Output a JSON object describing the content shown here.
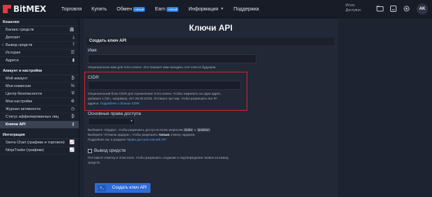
{
  "brand": {
    "name": "BitMEX",
    "color": "#e5393a"
  },
  "nav": {
    "items": [
      {
        "label": "Торговля",
        "badge": ""
      },
      {
        "label": "Купить",
        "badge": ""
      },
      {
        "label": "Обмен",
        "badge": "новый"
      },
      {
        "label": "Earn",
        "badge": "новый"
      },
      {
        "label": "Информация",
        "badge": ""
      },
      {
        "label": "Поддержка",
        "badge": ""
      }
    ]
  },
  "balance": {
    "total_label": "Итого",
    "available_label": "Доступно"
  },
  "user": {
    "initials": "AK"
  },
  "sidebar": {
    "wallet_title": "Кошелек",
    "wallet_items": [
      {
        "label": "Баланс средств",
        "icon": "bank-icon"
      },
      {
        "label": "Депозит",
        "icon": "download-icon"
      },
      {
        "label": "Вывод средств",
        "icon": "upload-icon"
      },
      {
        "label": "История",
        "icon": "list-icon"
      },
      {
        "label": "Адреса",
        "icon": "bookmark-icon"
      }
    ],
    "account_title": "Аккаунт и настройки",
    "account_items": [
      {
        "label": "Мой аккаунт",
        "icon": "bitcoin-icon"
      },
      {
        "label": "Мои комиссии",
        "icon": "percent-icon"
      },
      {
        "label": "Центр безопасности",
        "icon": "shield-icon"
      },
      {
        "label": "Мои настройки",
        "icon": "gear-icon"
      },
      {
        "label": "Журнал активности",
        "icon": "clock-icon"
      },
      {
        "label": "Статус аффилированных лиц",
        "icon": "bitcoin-icon"
      },
      {
        "label": "Ключи API",
        "icon": "key-icon"
      }
    ],
    "integration_title": "Интеграция",
    "integration_items": [
      {
        "label": "Sierra Chart (графики и торговля)",
        "icon": "chart-icon"
      },
      {
        "label": "NinjaTrader (графики)",
        "icon": "chart-icon"
      }
    ]
  },
  "page": {
    "title": "Ключи API",
    "card_title": "Создать ключ API",
    "name_label": "Имя",
    "name_hint": "Опциональное имя для этого ключа. Это поможет вам находить этот ключ в будущем.",
    "cidr_label": "CIDR",
    "cidr_hint_1": "Опциональный блок CIDR для ограничения этого ключа. Чтобы закрепить на один адрес,",
    "cidr_hint_2": "добавьте к /32», например, 207.39.29.22/32. Оставьте пустым, чтобы разрешить все IP-",
    "cidr_hint_3a": "адреса.",
    "cidr_hint_link": "Подробнее о блоках CIDR",
    "perm_label": "Основные права доступа",
    "perm_hint_1": "Выберите «Ордер», чтобы разрешить доступ ко всем запросам",
    "perm_code_1": "/order",
    "perm_and": "и",
    "perm_code_2": "/position",
    "perm_hint_2a": "Выберите «Отмена ордера», чтобы разрешить",
    "perm_hint_2b": "только",
    "perm_hint_2c": "отмену ордеров.",
    "perm_hint_3a": "Подробнее см. в разделе",
    "perm_hint_link": "Права доступа ключей API",
    "withdraw_label": "Вывод средств",
    "withdraw_hint_1": "Поставьте отметку в этом поле, чтобы разрешить создание и подтверждение заявок на вывод",
    "withdraw_hint_2": "средств.",
    "create_button": "Создать ключ API",
    "create_button_icon": "terminal-icon"
  },
  "colors": {
    "accent": "#2f6bd6",
    "highlight": "#d2262b",
    "link": "#5aa7f5"
  }
}
